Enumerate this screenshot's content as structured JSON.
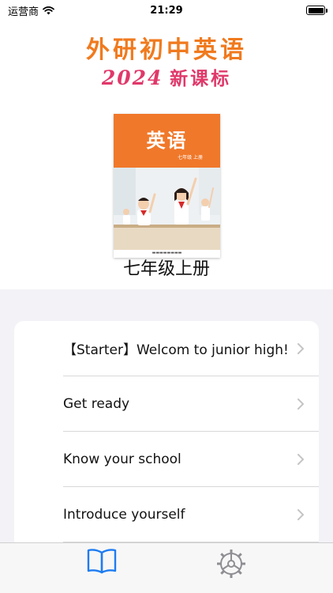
{
  "status_bar": {
    "carrier": "运营商",
    "time": "21:29"
  },
  "header": {
    "title": "外研初中英语",
    "year": "2024",
    "edition": "新课标"
  },
  "book": {
    "cover_title": "英语",
    "cover_grade": "七年级 上册",
    "grade_label": "七年级上册"
  },
  "units": [
    {
      "label": "【Starter】Welcom to junior high!"
    },
    {
      "label": "Get ready"
    },
    {
      "label": "Know your school"
    },
    {
      "label": "Introduce yourself"
    }
  ],
  "tabs": [
    {
      "name": "book-tab",
      "icon": "book-icon",
      "selected": true
    },
    {
      "name": "settings-tab",
      "icon": "gear-icon",
      "selected": false
    }
  ],
  "colors": {
    "title_orange": "#f07a1e",
    "subtitle_pink": "#e0386a",
    "tab_selected": "#1e7cf2",
    "tab_unselected": "#8e8e93",
    "list_background": "#f2f2f7"
  }
}
